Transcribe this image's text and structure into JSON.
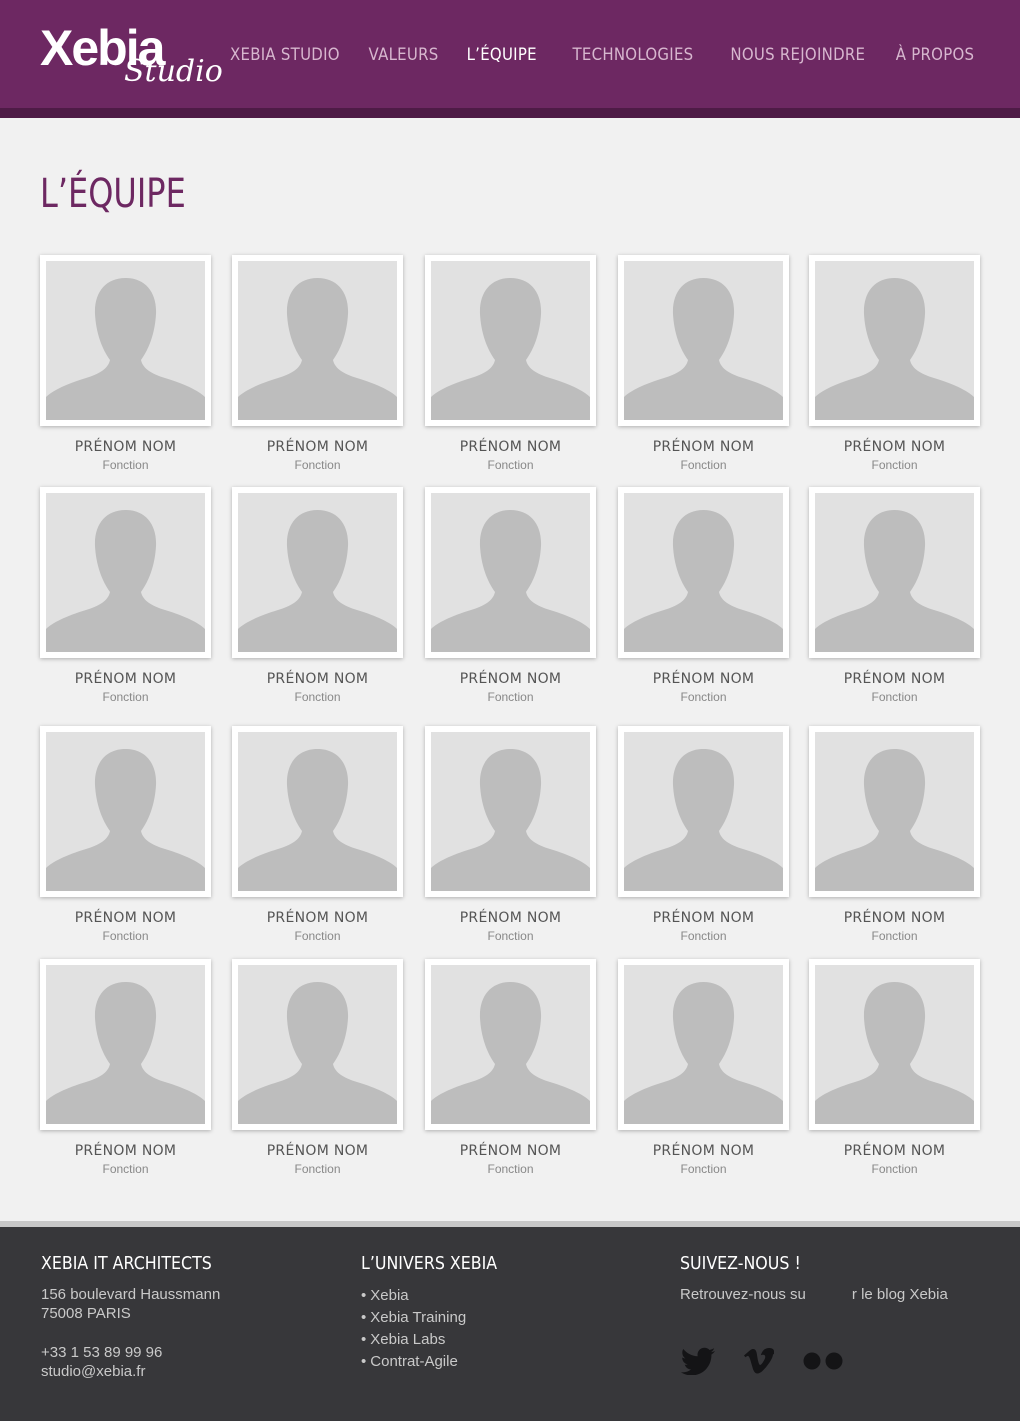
{
  "brand": {
    "logo_main": "Xebia",
    "logo_script": "Studio"
  },
  "nav": [
    {
      "label": "XEBIA STUDIO",
      "active": false
    },
    {
      "label": "VALEURS",
      "active": false
    },
    {
      "label": "L’ÉQUIPE",
      "active": true
    },
    {
      "label": "TECHNOLOGIES",
      "active": false
    },
    {
      "label": "NOUS REJOINDRE",
      "active": false
    },
    {
      "label": "À PROPOS",
      "active": false
    }
  ],
  "page": {
    "title": "L’ÉQUIPE"
  },
  "team": [
    {
      "name": "PRÉNOM NOM",
      "role": "Fonction"
    },
    {
      "name": "PRÉNOM NOM",
      "role": "Fonction"
    },
    {
      "name": "PRÉNOM NOM",
      "role": "Fonction"
    },
    {
      "name": "PRÉNOM NOM",
      "role": "Fonction"
    },
    {
      "name": "PRÉNOM NOM",
      "role": "Fonction"
    },
    {
      "name": "PRÉNOM NOM",
      "role": "Fonction"
    },
    {
      "name": "PRÉNOM NOM",
      "role": "Fonction"
    },
    {
      "name": "PRÉNOM NOM",
      "role": "Fonction"
    },
    {
      "name": "PRÉNOM NOM",
      "role": "Fonction"
    },
    {
      "name": "PRÉNOM NOM",
      "role": "Fonction"
    },
    {
      "name": "PRÉNOM NOM",
      "role": "Fonction"
    },
    {
      "name": "PRÉNOM NOM",
      "role": "Fonction"
    },
    {
      "name": "PRÉNOM NOM",
      "role": "Fonction"
    },
    {
      "name": "PRÉNOM NOM",
      "role": "Fonction"
    },
    {
      "name": "PRÉNOM NOM",
      "role": "Fonction"
    },
    {
      "name": "PRÉNOM NOM",
      "role": "Fonction"
    },
    {
      "name": "PRÉNOM NOM",
      "role": "Fonction"
    },
    {
      "name": "PRÉNOM NOM",
      "role": "Fonction"
    },
    {
      "name": "PRÉNOM NOM",
      "role": "Fonction"
    },
    {
      "name": "PRÉNOM NOM",
      "role": "Fonction"
    }
  ],
  "footer": {
    "contact": {
      "title": "XEBIA IT ARCHITECTS",
      "address_line1": "156 boulevard Haussmann",
      "address_line2": "75008 PARIS",
      "phone": "+33 1 53 89 99 96",
      "email": "studio@xebia.fr"
    },
    "univers": {
      "title": "L’UNIVERS XEBIA",
      "links": [
        "Xebia",
        "Xebia Training",
        "Xebia Labs",
        "Contrat-Agile"
      ]
    },
    "social": {
      "title": "SUIVEZ-NOUS !",
      "text_part1": "Retrouvez-nous su",
      "text_part2": "r le blog Xebia",
      "icons": [
        "twitter-icon",
        "vimeo-icon",
        "flickr-icon"
      ]
    }
  },
  "colors": {
    "brand_purple": "#6d2862",
    "header_border": "#4e1b46",
    "page_bg": "#f1f1f1",
    "footer_bg": "#37373a",
    "footer_border": "#c7c7c7",
    "placeholder_bg": "#e1e1e1",
    "silhouette": "#bdbdbd"
  }
}
